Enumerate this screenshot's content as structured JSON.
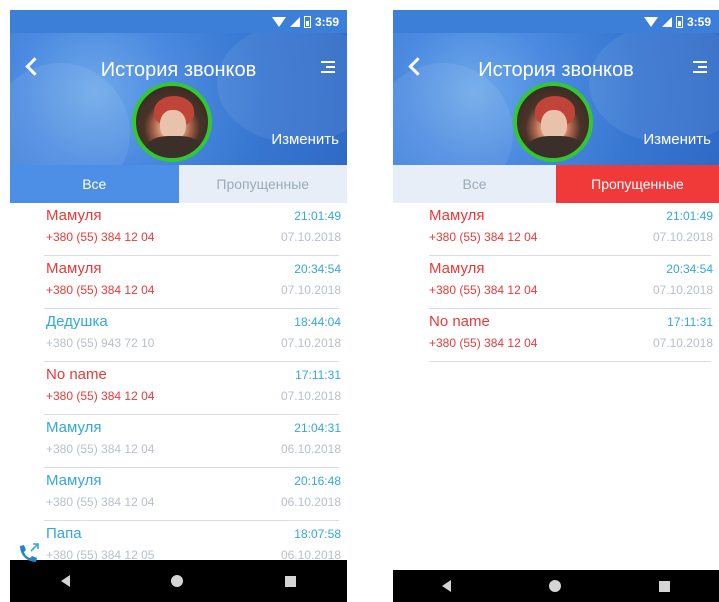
{
  "left_screen": {
    "status_time": "3:59",
    "title": "История звонков",
    "edit_label": "Изменить",
    "tabs": {
      "all": "Все",
      "missed": "Пропущенные",
      "active": "all"
    },
    "calls": [
      {
        "name": "Мамуля",
        "number": "+380 (55) 384 12 04",
        "time": "21:01:49",
        "date": "07.10.2018",
        "missed": true
      },
      {
        "name": "Мамуля",
        "number": "+380 (55) 384 12 04",
        "time": "20:34:54",
        "date": "07.10.2018",
        "missed": true
      },
      {
        "name": "Дедушка",
        "number": "+380 (55) 943 72 10",
        "time": "18:44:04",
        "date": "07.10.2018",
        "missed": false
      },
      {
        "name": "No name",
        "number": "+380 (55) 384 12 04",
        "time": "17:11:31",
        "date": "07.10.2018",
        "missed": true
      },
      {
        "name": "Мамуля",
        "number": "+380 (55) 384 12 04",
        "time": "21:04:31",
        "date": "06.10.2018",
        "missed": false
      },
      {
        "name": "Мамуля",
        "number": "+380 (55) 384 12 04",
        "time": "20:16:48",
        "date": "06.10.2018",
        "missed": false
      },
      {
        "name": "Папа",
        "number": "+380 (55) 384 12 05",
        "time": "18:07:58",
        "date": "06.10.2018",
        "missed": false
      }
    ]
  },
  "right_screen": {
    "status_time": "3:59",
    "title": "История звонков",
    "edit_label": "Изменить",
    "tabs": {
      "all": "Все",
      "missed": "Пропущенные",
      "active": "missed"
    },
    "calls": [
      {
        "name": "Мамуля",
        "number": "+380 (55) 384 12 04",
        "time": "21:01:49",
        "date": "07.10.2018",
        "missed": true
      },
      {
        "name": "Мамуля",
        "number": "+380 (55) 384 12 04",
        "time": "20:34:54",
        "date": "07.10.2018",
        "missed": true
      },
      {
        "name": "No name",
        "number": "+380 (55) 384 12 04",
        "time": "17:11:31",
        "date": "07.10.2018",
        "missed": true
      }
    ]
  },
  "colors": {
    "header_blue": "#3b7fd8",
    "missed_red": "#e83a3a",
    "normal_blue": "#34a7dc",
    "avatar_ring_green": "#32c832"
  },
  "icons": {
    "back": "back-arrow-icon",
    "menu": "menu-icon",
    "outgoing_call": "outgoing-call-icon"
  }
}
